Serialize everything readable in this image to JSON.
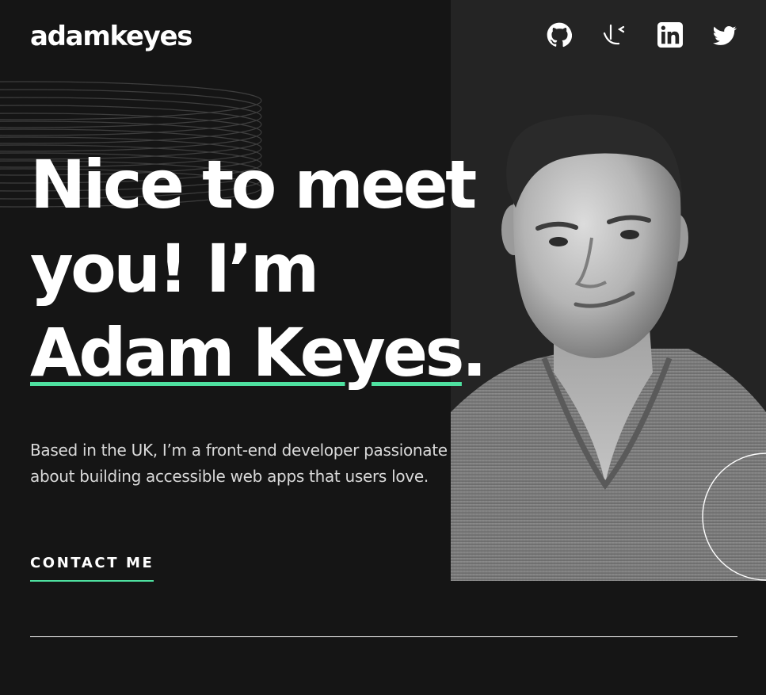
{
  "header": {
    "logo": "adamkeyes",
    "social": [
      {
        "name": "github-icon"
      },
      {
        "name": "frontend-mentor-icon"
      },
      {
        "name": "linkedin-icon"
      },
      {
        "name": "twitter-icon"
      }
    ]
  },
  "hero": {
    "title_line1": "Nice to meet",
    "title_line2": "you! I’m",
    "title_name": "Adam Keyes",
    "title_end": ".",
    "description": "Based in the UK, I’m a front-end developer passionate about building accessible web apps that users love.",
    "contact_label": "CONTACT ME"
  },
  "colors": {
    "background": "#151515",
    "panel": "#242424",
    "accent": "#4ee1a0",
    "text": "#ffffff",
    "muted_text": "#d9d9d9"
  }
}
